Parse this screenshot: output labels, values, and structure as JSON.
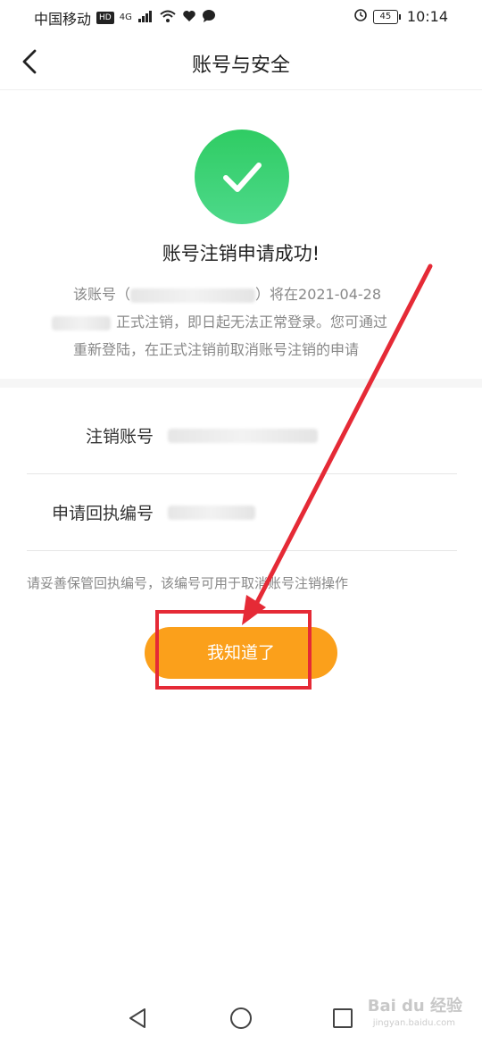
{
  "status_bar": {
    "carrier": "中国移动",
    "hd": "HD",
    "network": "4G",
    "battery": "45",
    "time": "10:14"
  },
  "nav": {
    "title": "账号与安全"
  },
  "success": {
    "title": "账号注销申请成功!",
    "desc_part1": "该账号（",
    "desc_part2": "）将在2021-04-28",
    "desc_part3": "正式注销，即日起无法正常登录。您可通过",
    "desc_part4": "重新登陆，在正式注销前取消账号注销的申请"
  },
  "info": {
    "account_label": "注销账号",
    "receipt_label": "申请回执编号"
  },
  "tip": "请妥善保管回执编号，该编号可用于取消账号注销操作",
  "confirm_button": "我知道了",
  "watermark": {
    "brand": "Bai du 经验",
    "url": "jingyan.baidu.com"
  },
  "colors": {
    "accent": "#fba01b",
    "success": "#2fcc63",
    "annotation": "#e52a36"
  }
}
